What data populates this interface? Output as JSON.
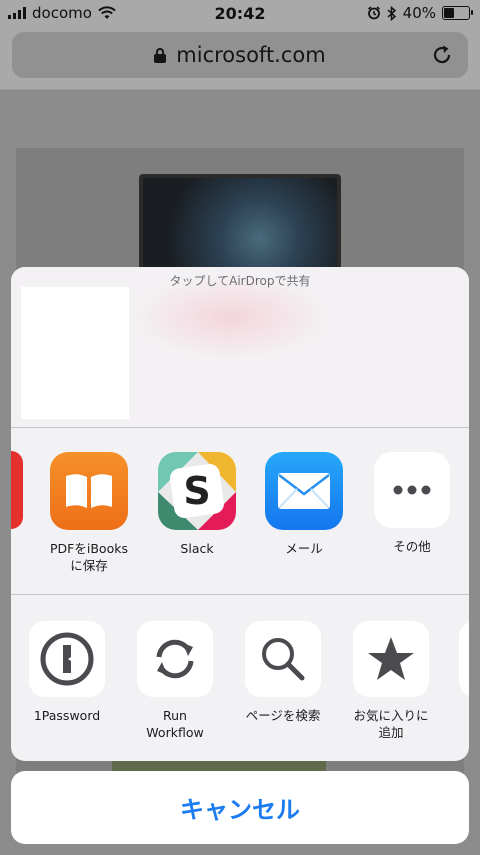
{
  "status_bar": {
    "carrier": "docomo",
    "time": "20:42",
    "battery": "40%",
    "battery_level": 0.4
  },
  "address_bar": {
    "url": "microsoft.com"
  },
  "share_sheet": {
    "airdrop_title": "タップしてAirDropで共有",
    "apps": [
      {
        "label": "PDFをiBooks\nに保存",
        "icon": "ibooks-icon"
      },
      {
        "label": "Slack",
        "icon": "slack-icon"
      },
      {
        "label": "メール",
        "icon": "mail-icon"
      },
      {
        "label": "その他",
        "icon": "more-icon"
      }
    ],
    "actions": [
      {
        "label": "1Password",
        "icon": "onepassword-icon"
      },
      {
        "label": "Run\nWorkflow",
        "icon": "workflow-icon"
      },
      {
        "label": "ページを検索",
        "icon": "search-icon"
      },
      {
        "label": "お気に入りに\n追加",
        "icon": "star-icon"
      }
    ],
    "cancel_label": "キャンセル"
  },
  "colors": {
    "accent": "#1b7cf2",
    "ibooks": "#f0801d",
    "mail": "#1a8cf5"
  }
}
